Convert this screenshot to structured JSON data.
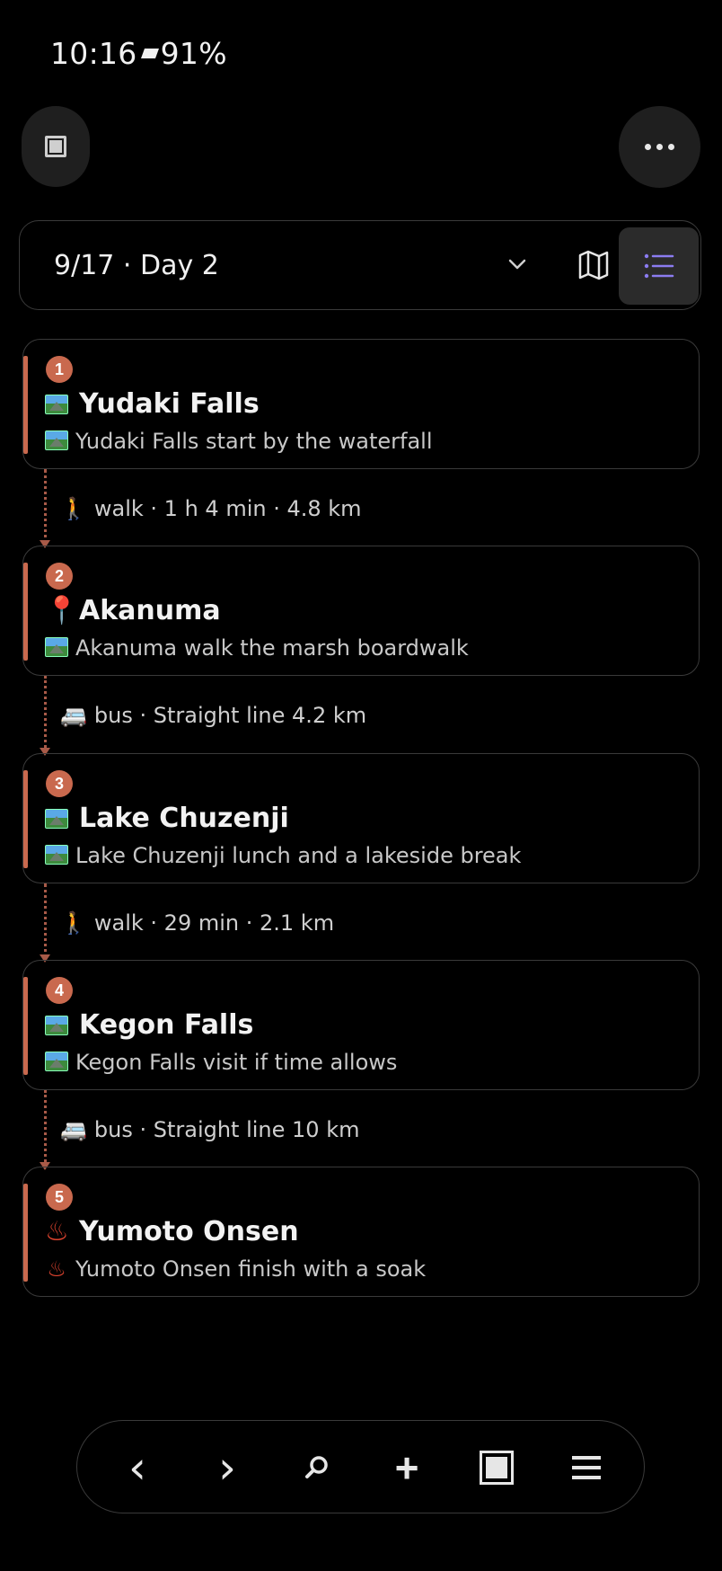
{
  "status_bar": {
    "time": "10:16",
    "battery": "91%"
  },
  "top_buttons": {
    "sidebar_icon": "square-icon",
    "more_icon": "more-icon"
  },
  "day_bar": {
    "title": "9/17 · Day 2",
    "dropdown_icon": "chevron-down-icon",
    "map_icon": "map-icon",
    "list_icon": "list-icon"
  },
  "stops": [
    {
      "number": "1",
      "name": "Yudaki Falls",
      "icon": "mountain-picture-icon",
      "note": "Yudaki Falls start by the waterfall"
    },
    {
      "number": "2",
      "name": "Akanuma",
      "icon": "pin-icon",
      "note": "Akanuma walk the marsh boardwalk"
    },
    {
      "number": "3",
      "name": "Lake Chuzenji",
      "icon": "mountain-picture-icon",
      "note": "Lake Chuzenji lunch and a lakeside break"
    },
    {
      "number": "4",
      "name": "Kegon Falls",
      "icon": "mountain-picture-icon",
      "note": "Kegon Falls visit if time allows"
    },
    {
      "number": "5",
      "name": "Yumoto Onsen",
      "icon": "hot-springs-icon",
      "note": "Yumoto Onsen finish with a soak"
    }
  ],
  "transits": [
    {
      "mode_icon": "walking-person-icon",
      "text": "walk · 1 h 4 min · 4.8 km"
    },
    {
      "mode_icon": "bus-icon",
      "text": "bus · Straight line 4.2 km"
    },
    {
      "mode_icon": "walking-person-icon",
      "text": "walk · 29 min · 2.1 km"
    },
    {
      "mode_icon": "bus-icon",
      "text": "bus · Straight line 10 km"
    }
  ],
  "bottom_bar": {
    "back_glyph": "‹",
    "forward_glyph": "›",
    "add_glyph": "+",
    "icons": [
      "back-icon",
      "forward-icon",
      "search-icon",
      "add-icon",
      "tabs-icon",
      "menu-icon"
    ]
  },
  "colors": {
    "accent": "#c9694e",
    "background": "#000000",
    "border": "#3a3a3a",
    "list_icon": "#8b7cf0"
  }
}
